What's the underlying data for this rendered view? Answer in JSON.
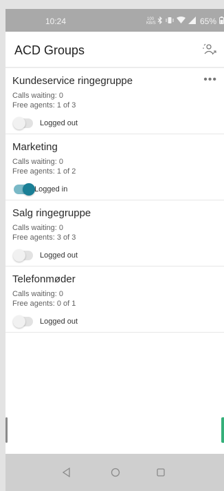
{
  "status_bar": {
    "time": "10:24",
    "net_speed": "100 KB/S",
    "battery": "65%",
    "icons": [
      "bluetooth-icon",
      "vibrate-icon",
      "wifi-icon",
      "signal-icon",
      "battery-icon"
    ]
  },
  "header": {
    "title": "ACD Groups",
    "action_icon": "agent-status-icon"
  },
  "groups": [
    {
      "name": "Kundeservice ringegruppe",
      "calls_waiting": "Calls waiting: 0",
      "free_agents": "Free agents:  1 of 3",
      "status": "Logged out",
      "logged_in": false,
      "has_more": true,
      "more": "•••"
    },
    {
      "name": "Marketing",
      "calls_waiting": "Calls waiting: 0",
      "free_agents": "Free agents:  1 of 2",
      "status": "Logged in",
      "logged_in": true,
      "has_more": false
    },
    {
      "name": "Salg ringegruppe",
      "calls_waiting": "Calls waiting: 0",
      "free_agents": "Free agents:  3 of 3",
      "status": "Logged out",
      "logged_in": false,
      "has_more": false
    },
    {
      "name": "Telefonmøder",
      "calls_waiting": "Calls waiting: 0",
      "free_agents": "Free agents:  0 of 1",
      "status": "Logged out",
      "logged_in": false,
      "has_more": false
    }
  ],
  "colors": {
    "accent": "#1a7f96",
    "status_bar": "#a9a9a9",
    "nav_bar": "#cfcfcf"
  },
  "nav": {
    "icons": [
      "back-icon",
      "home-icon",
      "recents-icon"
    ]
  }
}
